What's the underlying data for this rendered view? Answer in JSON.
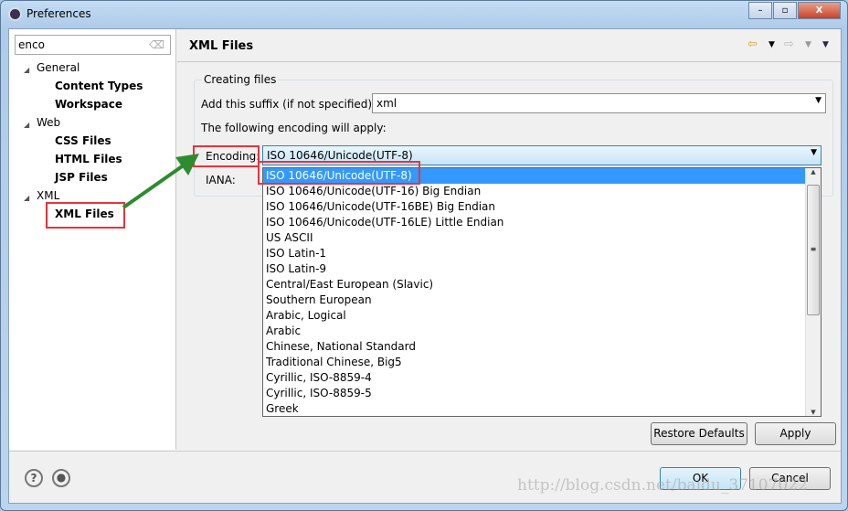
{
  "window": {
    "title": "Preferences",
    "minimize": "–",
    "restore": "▫",
    "close": "X"
  },
  "sidebar": {
    "search_value": "enco",
    "tree": [
      {
        "label": "General",
        "children": [
          "Content Types",
          "Workspace"
        ]
      },
      {
        "label": "Web",
        "children": [
          "CSS Files",
          "HTML Files",
          "JSP Files"
        ]
      },
      {
        "label": "XML",
        "children": [
          "XML Files"
        ]
      }
    ],
    "selected": "XML Files"
  },
  "page": {
    "title": "XML Files",
    "group_title": "Creating files",
    "suffix_label": "Add this suffix (if not specified):",
    "suffix_value": "xml",
    "encoding_note": "The following encoding will apply:",
    "encoding_label": "Encoding:",
    "encoding_value": "ISO 10646/Unicode(UTF-8)",
    "iana_label": "IANA:"
  },
  "encoding_options": [
    "ISO 10646/Unicode(UTF-8)",
    "ISO 10646/Unicode(UTF-16) Big Endian",
    "ISO 10646/Unicode(UTF-16BE) Big Endian",
    "ISO 10646/Unicode(UTF-16LE) Little Endian",
    "US ASCII",
    "ISO Latin-1",
    "ISO Latin-9",
    "Central/East European (Slavic)",
    "Southern European",
    "Arabic, Logical",
    "Arabic",
    "Chinese, National Standard",
    "Traditional Chinese, Big5",
    "Cyrillic, ISO-8859-4",
    "Cyrillic, ISO-8859-5",
    "Greek"
  ],
  "buttons": {
    "restore_defaults": "Restore Defaults",
    "apply": "Apply",
    "ok": "OK",
    "cancel": "Cancel"
  },
  "watermark": "http://blog.csdn.net/baidu_37107022",
  "colors": {
    "highlight_box": "#e8333b",
    "selection": "#3399ff",
    "arrow": "#2e8b2e"
  }
}
